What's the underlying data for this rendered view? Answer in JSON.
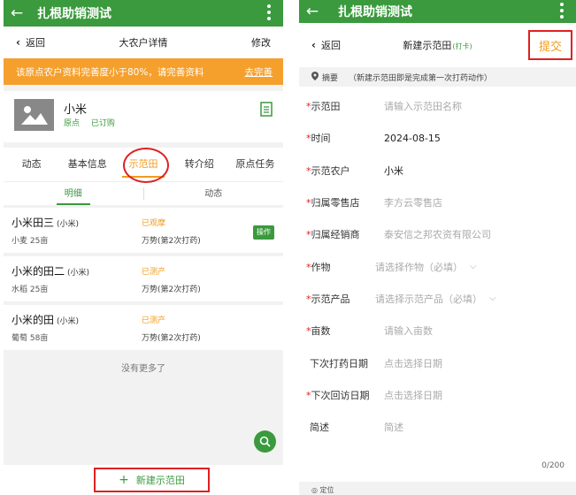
{
  "left": {
    "appbar": {
      "title": "扎根助销测试"
    },
    "nav": {
      "back": "返回",
      "title": "大农户详情",
      "action": "修改"
    },
    "warning": {
      "text": "该原点农户资料完善度小于80%，请完善资料",
      "link": "去完善"
    },
    "profile": {
      "name": "小米",
      "tags": [
        "原点",
        "已订购"
      ]
    },
    "tabs": [
      "动态",
      "基本信息",
      "示范田",
      "转介绍",
      "原点任务"
    ],
    "active_tab": "示范田",
    "subtabs": [
      "明细",
      "动态"
    ],
    "items": [
      {
        "name": "小米田三",
        "owner": "(小米)",
        "crop": "小麦  25亩",
        "status": "已观摩",
        "drug": "万势(第2次打药)",
        "op": "操作"
      },
      {
        "name": "小米的田二",
        "owner": "(小米)",
        "crop": "水稻  25亩",
        "status": "已测产",
        "drug": "万势(第2次打药)",
        "op": ""
      },
      {
        "name": "小米的田",
        "owner": "(小米)",
        "crop": "葡萄  58亩",
        "status": "已测产",
        "drug": "万势(第2次打药)",
        "op": ""
      }
    ],
    "no_more": "没有更多了",
    "create_button": "新建示范田"
  },
  "right": {
    "appbar": {
      "title": "扎根助销测试"
    },
    "nav": {
      "back": "返回",
      "title": "新建示范田",
      "tag": "(打卡)",
      "action": "提交"
    },
    "summary": {
      "label": "摘要",
      "hint": "（新建示范田即是完成第一次打药动作）"
    },
    "fields": [
      {
        "label": "示范田",
        "required": true,
        "value": "请输入示范田名称",
        "placeholder": true,
        "select": false
      },
      {
        "label": "时间",
        "required": true,
        "value": "2024-08-15",
        "placeholder": false,
        "select": false
      },
      {
        "label": "示范农户",
        "required": true,
        "value": "小米",
        "placeholder": false,
        "select": false
      },
      {
        "label": "归属零售店",
        "required": true,
        "value": "李方云零售店",
        "placeholder": true,
        "select": false
      },
      {
        "label": "归属经销商",
        "required": true,
        "value": "泰安信之邦农资有限公司",
        "placeholder": true,
        "select": false
      },
      {
        "label": "作物",
        "required": true,
        "value": "请选择作物（必填）",
        "placeholder": true,
        "select": true
      },
      {
        "label": "示范产品",
        "required": true,
        "value": "请选择示范产品（必填）",
        "placeholder": true,
        "select": true
      },
      {
        "label": "亩数",
        "required": true,
        "value": "请输入亩数",
        "placeholder": true,
        "select": false
      },
      {
        "label": "下次打药日期",
        "required": false,
        "value": "点击选择日期",
        "placeholder": true,
        "select": false
      },
      {
        "label": "下次回访日期",
        "required": true,
        "value": "点击选择日期",
        "placeholder": true,
        "select": false
      },
      {
        "label": "简述",
        "required": false,
        "value": "简述",
        "placeholder": true,
        "select": false
      }
    ],
    "counter": "0/200",
    "bottom_hint": "定位"
  },
  "colors": {
    "primary": "#3a9a3d",
    "accent": "#f29b1d",
    "warning_bg": "#f5a02d",
    "highlight": "#e02020"
  }
}
